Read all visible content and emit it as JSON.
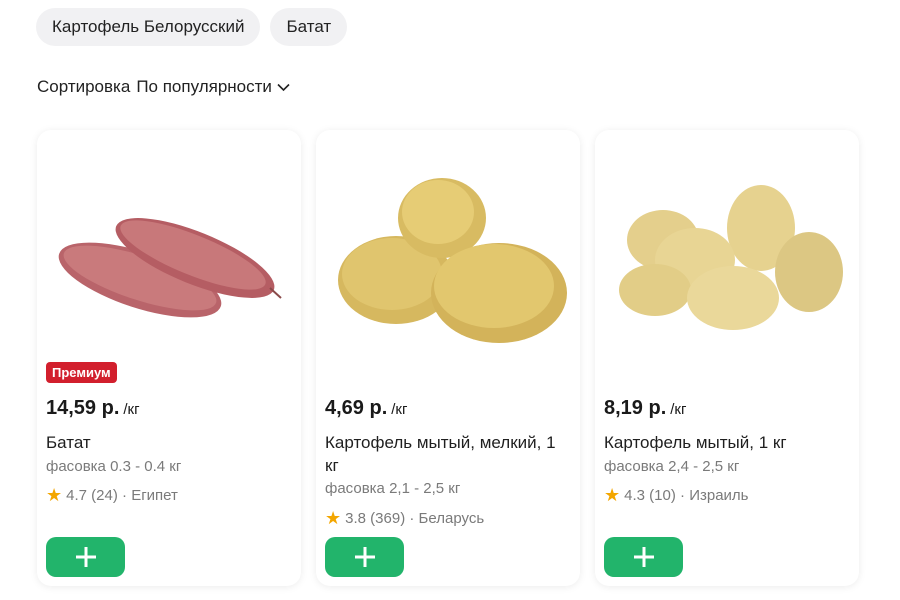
{
  "filters": {
    "chips": [
      {
        "label": "Картофель Белорусский"
      },
      {
        "label": "Батат"
      }
    ]
  },
  "sort": {
    "label": "Сортировка",
    "value": "По популярности",
    "icon": "chevron-down-icon"
  },
  "products": [
    {
      "badge": "Премиум",
      "price": "14,59 р.",
      "unit": "/кг",
      "name": "Батат",
      "package": "фасовка 0.3 - 0.4 кг",
      "rating": "4.7",
      "reviews": "(24)",
      "origin": "· Египет",
      "image": "sweet-potato-image"
    },
    {
      "price": "4,69 р.",
      "unit": "/кг",
      "name": "Картофель мытый, мелкий, 1 кг",
      "package": "фасовка 2,1 - 2,5 кг",
      "rating": "3.8",
      "reviews": "(369)",
      "origin": "· Беларусь",
      "image": "potatoes-image"
    },
    {
      "price": "8,19 р.",
      "unit": "/кг",
      "name": "Картофель мытый, 1 кг",
      "package": "фасовка 2,4 - 2,5 кг",
      "rating": "4.3",
      "reviews": "(10)",
      "origin": "· Израиль",
      "image": "potatoes-image"
    }
  ],
  "colors": {
    "accent_green": "#22b46b",
    "badge_red": "#d21f2d",
    "star": "#f3a600"
  }
}
